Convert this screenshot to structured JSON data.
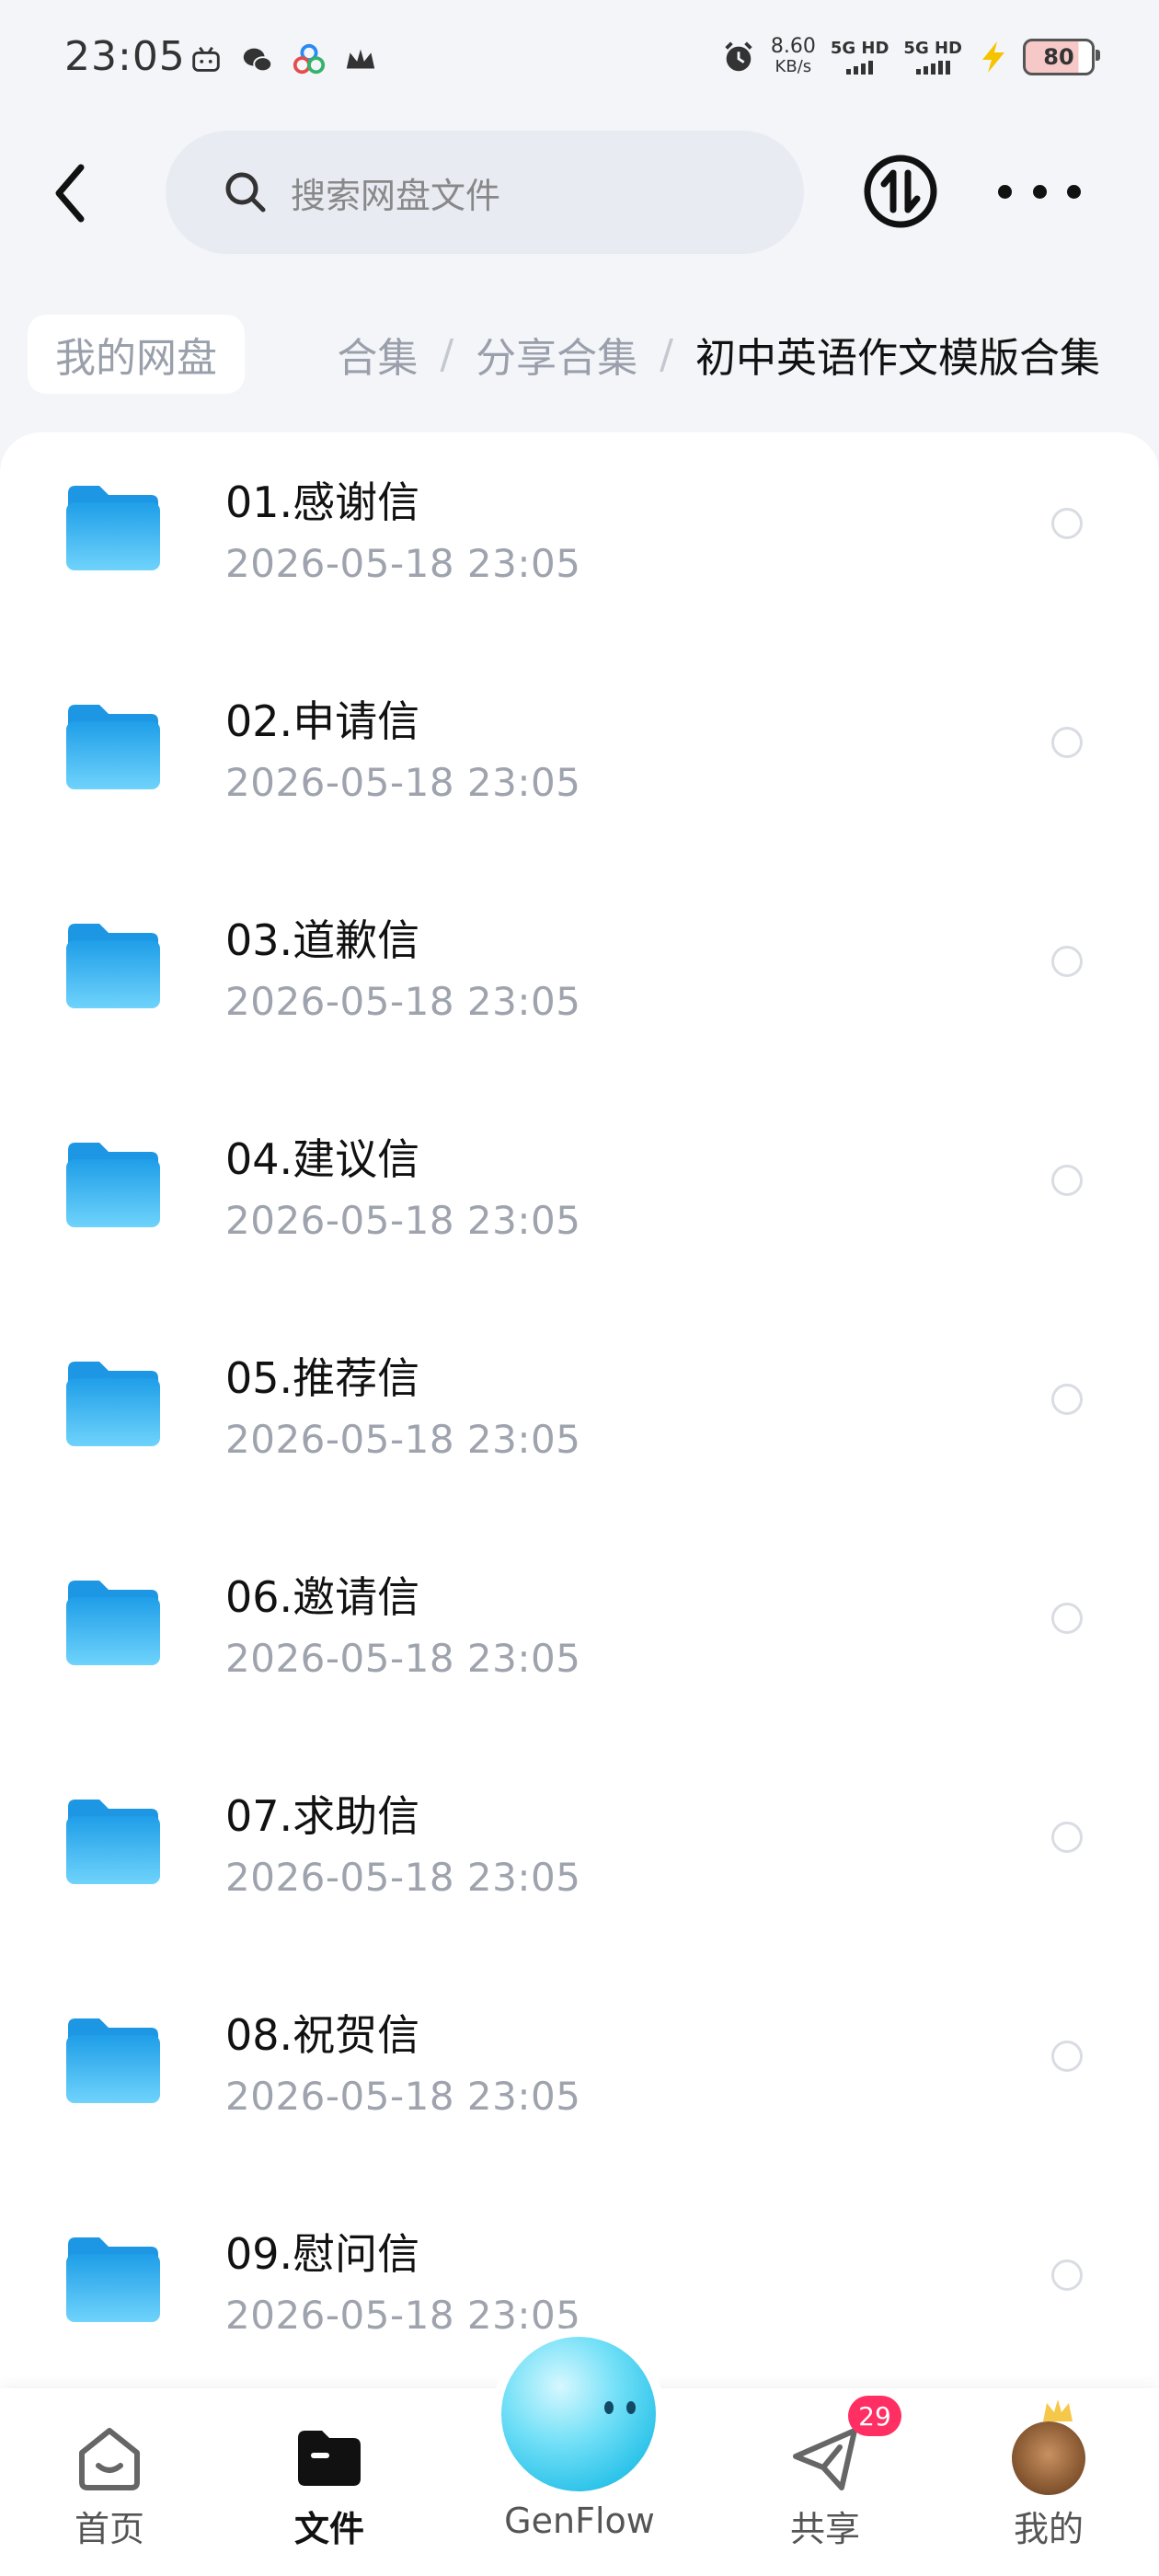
{
  "status_bar": {
    "time": "23:05",
    "net_speed_value": "8.60",
    "net_speed_unit": "KB/s",
    "sim1": "5G HD",
    "sim2": "5G HD",
    "battery": "80"
  },
  "header": {
    "search_placeholder": "搜索网盘文件"
  },
  "breadcrumb": {
    "root": "我的网盘",
    "partial": "合集",
    "items": [
      "分享合集",
      "初中英语作文模版合集"
    ],
    "separator": "/"
  },
  "files": [
    {
      "name": "01.感谢信",
      "date": "2026-05-18  23:05"
    },
    {
      "name": "02.申请信",
      "date": "2026-05-18  23:05"
    },
    {
      "name": "03.道歉信",
      "date": "2026-05-18  23:05"
    },
    {
      "name": "04.建议信",
      "date": "2026-05-18  23:05"
    },
    {
      "name": "05.推荐信",
      "date": "2026-05-18  23:05"
    },
    {
      "name": "06.邀请信",
      "date": "2026-05-18  23:05"
    },
    {
      "name": "07.求助信",
      "date": "2026-05-18  23:05"
    },
    {
      "name": "08.祝贺信",
      "date": "2026-05-18  23:05"
    },
    {
      "name": "09.慰问信",
      "date": "2026-05-18  23:05"
    }
  ],
  "bottom_nav": {
    "home": "首页",
    "files": "文件",
    "genflow": "GenFlow",
    "share": "共享",
    "share_badge": "29",
    "me": "我的"
  },
  "colors": {
    "folder": "#3fb8f0",
    "accent_orb": "#2fc4ea",
    "badge": "#ff2e63",
    "secondary_text": "#9ea3ad"
  }
}
